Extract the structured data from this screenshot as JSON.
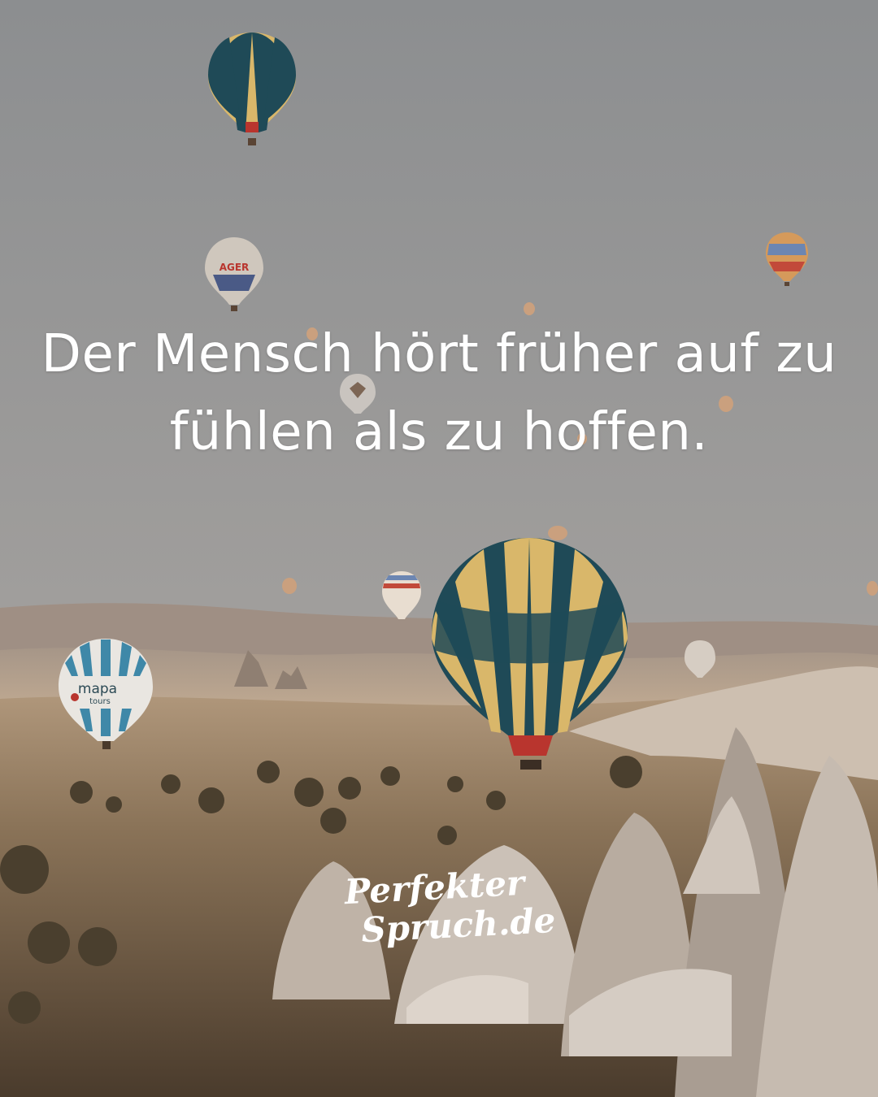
{
  "quote": {
    "line1": "Der Mensch hört früher auf zu",
    "line2": "fühlen als zu hoffen."
  },
  "logo": {
    "line1": "Perfekter",
    "line2": "Spruch.de"
  },
  "balloons": {
    "left_label_1": "mapa",
    "left_label_2": "tours",
    "small_label": "AGER"
  },
  "colors": {
    "sky_top": "#8c8e90",
    "sky_bottom": "#b6aca4",
    "balloon_teal": "#1f4a57",
    "balloon_yellow": "#d9b76a",
    "balloon_red": "#b9352e",
    "rock": "#c8beb4",
    "ground": "#6f5b43"
  }
}
